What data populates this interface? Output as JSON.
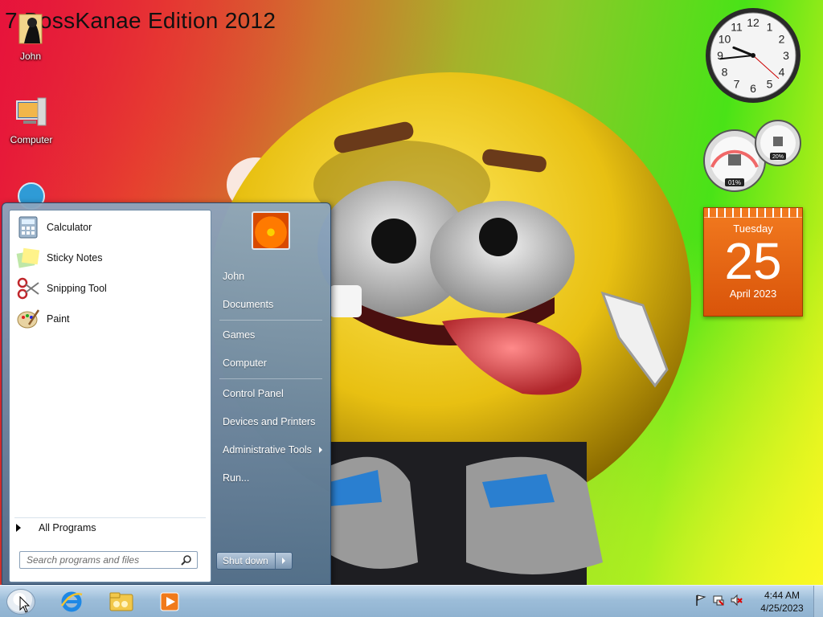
{
  "desktop": {
    "watermark": "7 BossKanae Edition 2012",
    "icons": [
      {
        "label": "John",
        "icon": "user-folder-icon"
      },
      {
        "label": "Computer",
        "icon": "computer-icon"
      },
      {
        "label": "",
        "icon": "network-icon"
      }
    ]
  },
  "gadgets": {
    "clock": {
      "hour": 9,
      "minute": 44,
      "second": 22
    },
    "cpu_meter": {
      "cpu": "01%",
      "memory": "20%"
    },
    "calendar": {
      "weekday": "Tuesday",
      "day": "25",
      "month_year": "April 2023"
    }
  },
  "start_menu": {
    "pinned_programs": [
      {
        "label": "Calculator",
        "icon": "calculator-icon"
      },
      {
        "label": "Sticky Notes",
        "icon": "sticky-notes-icon"
      },
      {
        "label": "Snipping Tool",
        "icon": "scissors-icon"
      },
      {
        "label": "Paint",
        "icon": "palette-icon"
      }
    ],
    "all_programs": "All Programs",
    "search_placeholder": "Search programs and files",
    "right_items": [
      {
        "label": "John"
      },
      {
        "label": "Documents"
      },
      {
        "label": "Games"
      },
      {
        "label": "Computer"
      },
      {
        "label": "Control Panel"
      },
      {
        "label": "Devices and Printers"
      },
      {
        "label": "Administrative Tools"
      },
      {
        "label": "Run..."
      }
    ],
    "shutdown_label": "Shut down"
  },
  "taskbar": {
    "pinned": [
      {
        "name": "internet-explorer-icon"
      },
      {
        "name": "windows-explorer-icon"
      },
      {
        "name": "media-player-icon"
      }
    ],
    "tray": [
      "action-center-flag-icon",
      "network-icon",
      "volume-muted-icon"
    ],
    "time": "4:44 AM",
    "date": "4/25/2023"
  },
  "colors": {
    "accent_orange": "#e8640f",
    "taskbar": "#9cbdd9"
  }
}
